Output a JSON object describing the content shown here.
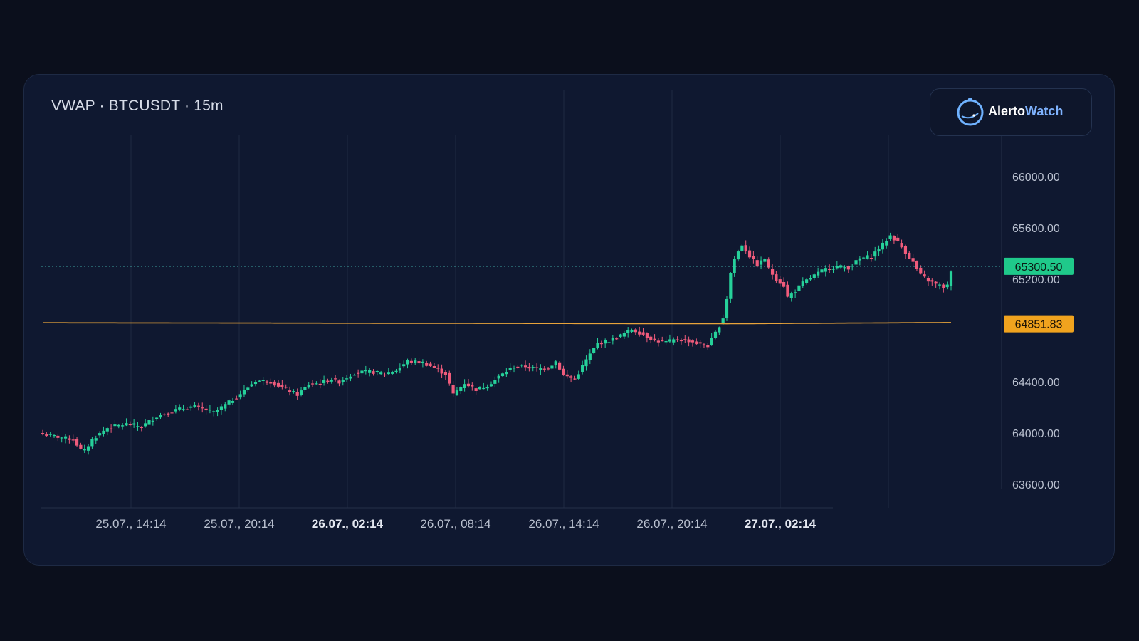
{
  "chart_title": "VWAP · BTCUSDT · 15m",
  "logo": {
    "part1": "Alerto",
    "part2": "Watch",
    "icon": "watch-logo-icon"
  },
  "colors": {
    "up": "#26d19a",
    "down": "#ef5b7b",
    "vwap": "#e8a33a",
    "grid": "#1f2a42",
    "axis_text": "#b9c0cf",
    "last_price_badge": "#1fc98a",
    "vwap_badge": "#f0a31e"
  },
  "chart_data": {
    "type": "candlestick",
    "symbol": "BTCUSDT",
    "interval": "15m",
    "indicator": "VWAP",
    "ylim": [
      63600,
      66300
    ],
    "y_ticks": [
      "66000.00",
      "65600.00",
      "65200.00",
      "64400.00",
      "64000.00",
      "63600.00"
    ],
    "x_ticks": [
      {
        "label": "25.07., 14:14",
        "bold": false
      },
      {
        "label": "25.07., 20:14",
        "bold": false
      },
      {
        "label": "26.07., 02:14",
        "bold": true
      },
      {
        "label": "26.07., 08:14",
        "bold": false
      },
      {
        "label": "26.07., 14:14",
        "bold": false
      },
      {
        "label": "26.07., 20:14",
        "bold": false
      },
      {
        "label": "27.07., 02:14",
        "bold": true
      }
    ],
    "last_price": "65300.50",
    "vwap_value": "64851.83",
    "vwap_start": 64860,
    "close_path": [
      [
        0,
        63990
      ],
      [
        8,
        63950
      ],
      [
        10,
        63870
      ],
      [
        11,
        63860
      ],
      [
        13,
        63950
      ],
      [
        17,
        64040
      ],
      [
        22,
        64070
      ],
      [
        26,
        64050
      ],
      [
        30,
        64130
      ],
      [
        35,
        64180
      ],
      [
        40,
        64210
      ],
      [
        45,
        64160
      ],
      [
        50,
        64260
      ],
      [
        53,
        64330
      ],
      [
        56,
        64410
      ],
      [
        60,
        64400
      ],
      [
        64,
        64340
      ],
      [
        67,
        64300
      ],
      [
        70,
        64380
      ],
      [
        73,
        64390
      ],
      [
        76,
        64420
      ],
      [
        78,
        64400
      ],
      [
        82,
        64470
      ],
      [
        86,
        64480
      ],
      [
        90,
        64460
      ],
      [
        93,
        64490
      ],
      [
        96,
        64560
      ],
      [
        100,
        64550
      ],
      [
        103,
        64510
      ],
      [
        106,
        64460
      ],
      [
        108,
        64300
      ],
      [
        111,
        64390
      ],
      [
        114,
        64340
      ],
      [
        117,
        64370
      ],
      [
        120,
        64440
      ],
      [
        124,
        64520
      ],
      [
        127,
        64520
      ],
      [
        130,
        64500
      ],
      [
        133,
        64510
      ],
      [
        135,
        64560
      ],
      [
        137,
        64450
      ],
      [
        140,
        64420
      ],
      [
        143,
        64570
      ],
      [
        146,
        64700
      ],
      [
        149,
        64720
      ],
      [
        152,
        64760
      ],
      [
        155,
        64810
      ],
      [
        158,
        64770
      ],
      [
        161,
        64720
      ],
      [
        164,
        64710
      ],
      [
        167,
        64730
      ],
      [
        170,
        64720
      ],
      [
        173,
        64690
      ],
      [
        175,
        64680
      ],
      [
        177,
        64780
      ],
      [
        179,
        64900
      ],
      [
        180,
        65050
      ],
      [
        181,
        65250
      ],
      [
        182,
        65360
      ],
      [
        184,
        65470
      ],
      [
        186,
        65380
      ],
      [
        188,
        65310
      ],
      [
        190,
        65360
      ],
      [
        191,
        65280
      ],
      [
        193,
        65200
      ],
      [
        195,
        65150
      ],
      [
        196,
        65060
      ],
      [
        198,
        65110
      ],
      [
        200,
        65170
      ],
      [
        203,
        65230
      ],
      [
        206,
        65280
      ],
      [
        209,
        65300
      ],
      [
        212,
        65290
      ],
      [
        215,
        65360
      ],
      [
        218,
        65380
      ],
      [
        221,
        65470
      ],
      [
        223,
        65540
      ],
      [
        225,
        65490
      ],
      [
        227,
        65410
      ],
      [
        229,
        65330
      ],
      [
        231,
        65230
      ],
      [
        233,
        65190
      ],
      [
        235,
        65160
      ],
      [
        237,
        65140
      ],
      [
        238,
        65150
      ],
      [
        239,
        65250
      ]
    ]
  }
}
